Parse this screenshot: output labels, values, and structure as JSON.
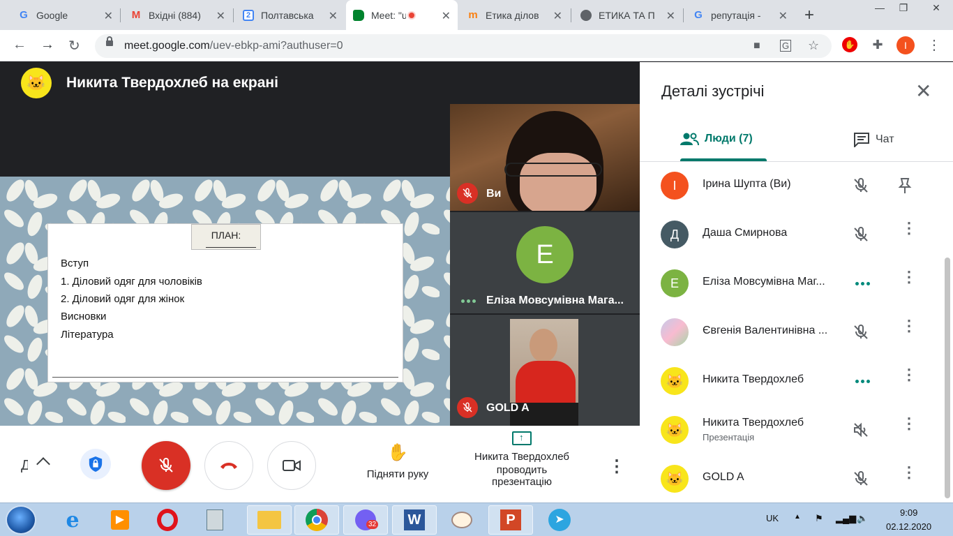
{
  "browser": {
    "tabs": [
      {
        "title": "Google",
        "icon": "google-icon",
        "active": false
      },
      {
        "title": "Вхідні (884)",
        "icon": "gmail-icon",
        "active": false
      },
      {
        "title": "Полтавська",
        "icon": "calendar-icon",
        "active": false
      },
      {
        "title": "Meet: \"u",
        "icon": "meet-icon",
        "active": true
      },
      {
        "title": "Етика ділов",
        "icon": "moodle-icon",
        "active": false
      },
      {
        "title": "ЕТИКА ТА П",
        "icon": "globe-icon",
        "active": false
      },
      {
        "title": "репутація -",
        "icon": "google-icon",
        "active": false
      }
    ],
    "url_host": "meet.google.com",
    "url_path": "/uev-ebkp-ami?authuser=0",
    "profile_initial": "I"
  },
  "meeting": {
    "presenter_banner": "Никита Твердохлеб на екрані",
    "slide": {
      "title": "ПЛАН:",
      "lines": [
        "Вступ",
        "1. Діловий одяг для чоловіків",
        "2. Діловий одяг для жінок",
        "Висновки",
        "Література"
      ]
    },
    "tiles": [
      {
        "name": "Ви",
        "muted": true
      },
      {
        "name": "Еліза Мовсумівна Мага...",
        "initial": "Е",
        "muted": false
      },
      {
        "name": "GOLD A",
        "muted": true
      }
    ]
  },
  "controls": {
    "raise_hand_label": "Підняти руку",
    "presenting_line1": "Никита Твердохлеб",
    "presenting_line2": "проводить",
    "presenting_line3": "презентацію",
    "left_glyph": "Д"
  },
  "details": {
    "title": "Деталі зустрічі",
    "people_tab": "Люди (7)",
    "chat_tab": "Чат",
    "people": [
      {
        "name": "Ірина Шупта (Ви)",
        "initial": "І",
        "color": "#f4511e",
        "state": "muted",
        "action": "pin-icon"
      },
      {
        "name": "Даша Смирнова",
        "initial": "Д",
        "color": "#455a64",
        "state": "muted",
        "action": "more-icon"
      },
      {
        "name": "Еліза Мовсумівна Маг...",
        "initial": "Е",
        "color": "#7cb342",
        "state": "speaking",
        "action": "more-icon"
      },
      {
        "name": "Євгенія Валентинівна ...",
        "initial": "",
        "color": "#b0bec5",
        "state": "muted",
        "action": "more-icon"
      },
      {
        "name": "Никита Твердохлеб",
        "initial": "",
        "color": "#f8e51b",
        "state": "speaking",
        "action": "more-icon"
      },
      {
        "name": "Никита Твердохлеб",
        "subtitle": "Презентація",
        "initial": "",
        "color": "#f8e51b",
        "state": "sound-off",
        "action": "more-icon"
      },
      {
        "name": "GOLD A",
        "initial": "",
        "color": "#f8e51b",
        "state": "muted",
        "action": "more-icon"
      }
    ]
  },
  "taskbar": {
    "lang": "UK",
    "time": "9:09",
    "date": "02.12.2020",
    "viber_badge": "32"
  }
}
